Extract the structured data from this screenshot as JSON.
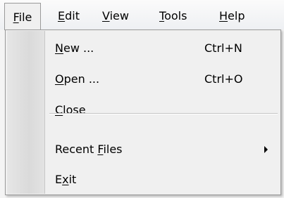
{
  "menubar": {
    "items": [
      {
        "label": "File",
        "mnemonic": "F"
      },
      {
        "label": "Edit",
        "mnemonic": "E"
      },
      {
        "label": "View",
        "mnemonic": "V"
      },
      {
        "label": "Tools",
        "mnemonic": "T"
      },
      {
        "label": "Help",
        "mnemonic": "H"
      }
    ]
  },
  "file_menu": {
    "items": [
      {
        "label": "New ...",
        "shortcut": "Ctrl+N"
      },
      {
        "label": "Open ...",
        "shortcut": "Ctrl+O"
      },
      {
        "label": "Close"
      },
      {
        "label": "Recent Files",
        "submenu_icon": "submenu-arrow-icon"
      },
      {
        "label": "Exit"
      }
    ]
  }
}
